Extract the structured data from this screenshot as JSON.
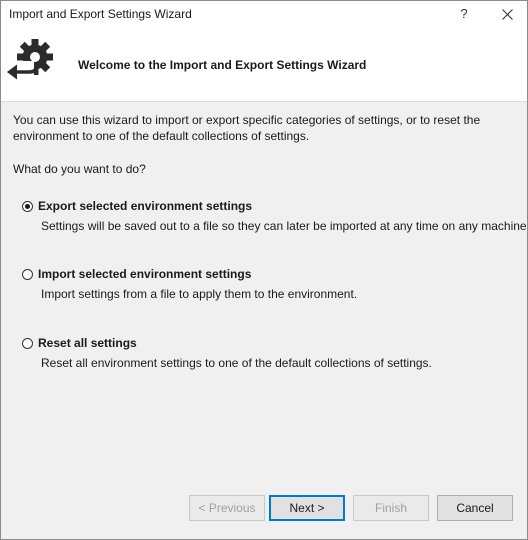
{
  "window": {
    "title": "Import and Export Settings Wizard",
    "help_glyph": "?",
    "close_icon": "close-icon"
  },
  "header": {
    "icon": "gear-arrow-icon",
    "title": "Welcome to the Import and Export Settings Wizard"
  },
  "intro": "You can use this wizard to import or export specific categories of settings, or to reset the environment to one of the default collections of settings.",
  "question": "What do you want to do?",
  "options": [
    {
      "label": "Export selected environment settings",
      "description": "Settings will be saved out to a file so they can later be imported at any time on any machine.",
      "selected": true
    },
    {
      "label": "Import selected environment settings",
      "description": "Import settings from a file to apply them to the environment.",
      "selected": false
    },
    {
      "label": "Reset all settings",
      "description": "Reset all environment settings to one of the default collections of settings.",
      "selected": false
    }
  ],
  "buttons": {
    "previous": "< Previous",
    "next": "Next >",
    "finish": "Finish",
    "cancel": "Cancel"
  },
  "colors": {
    "accent": "#0078d7",
    "dialog_bg": "#f0f0f0",
    "header_bg": "#ffffff"
  }
}
